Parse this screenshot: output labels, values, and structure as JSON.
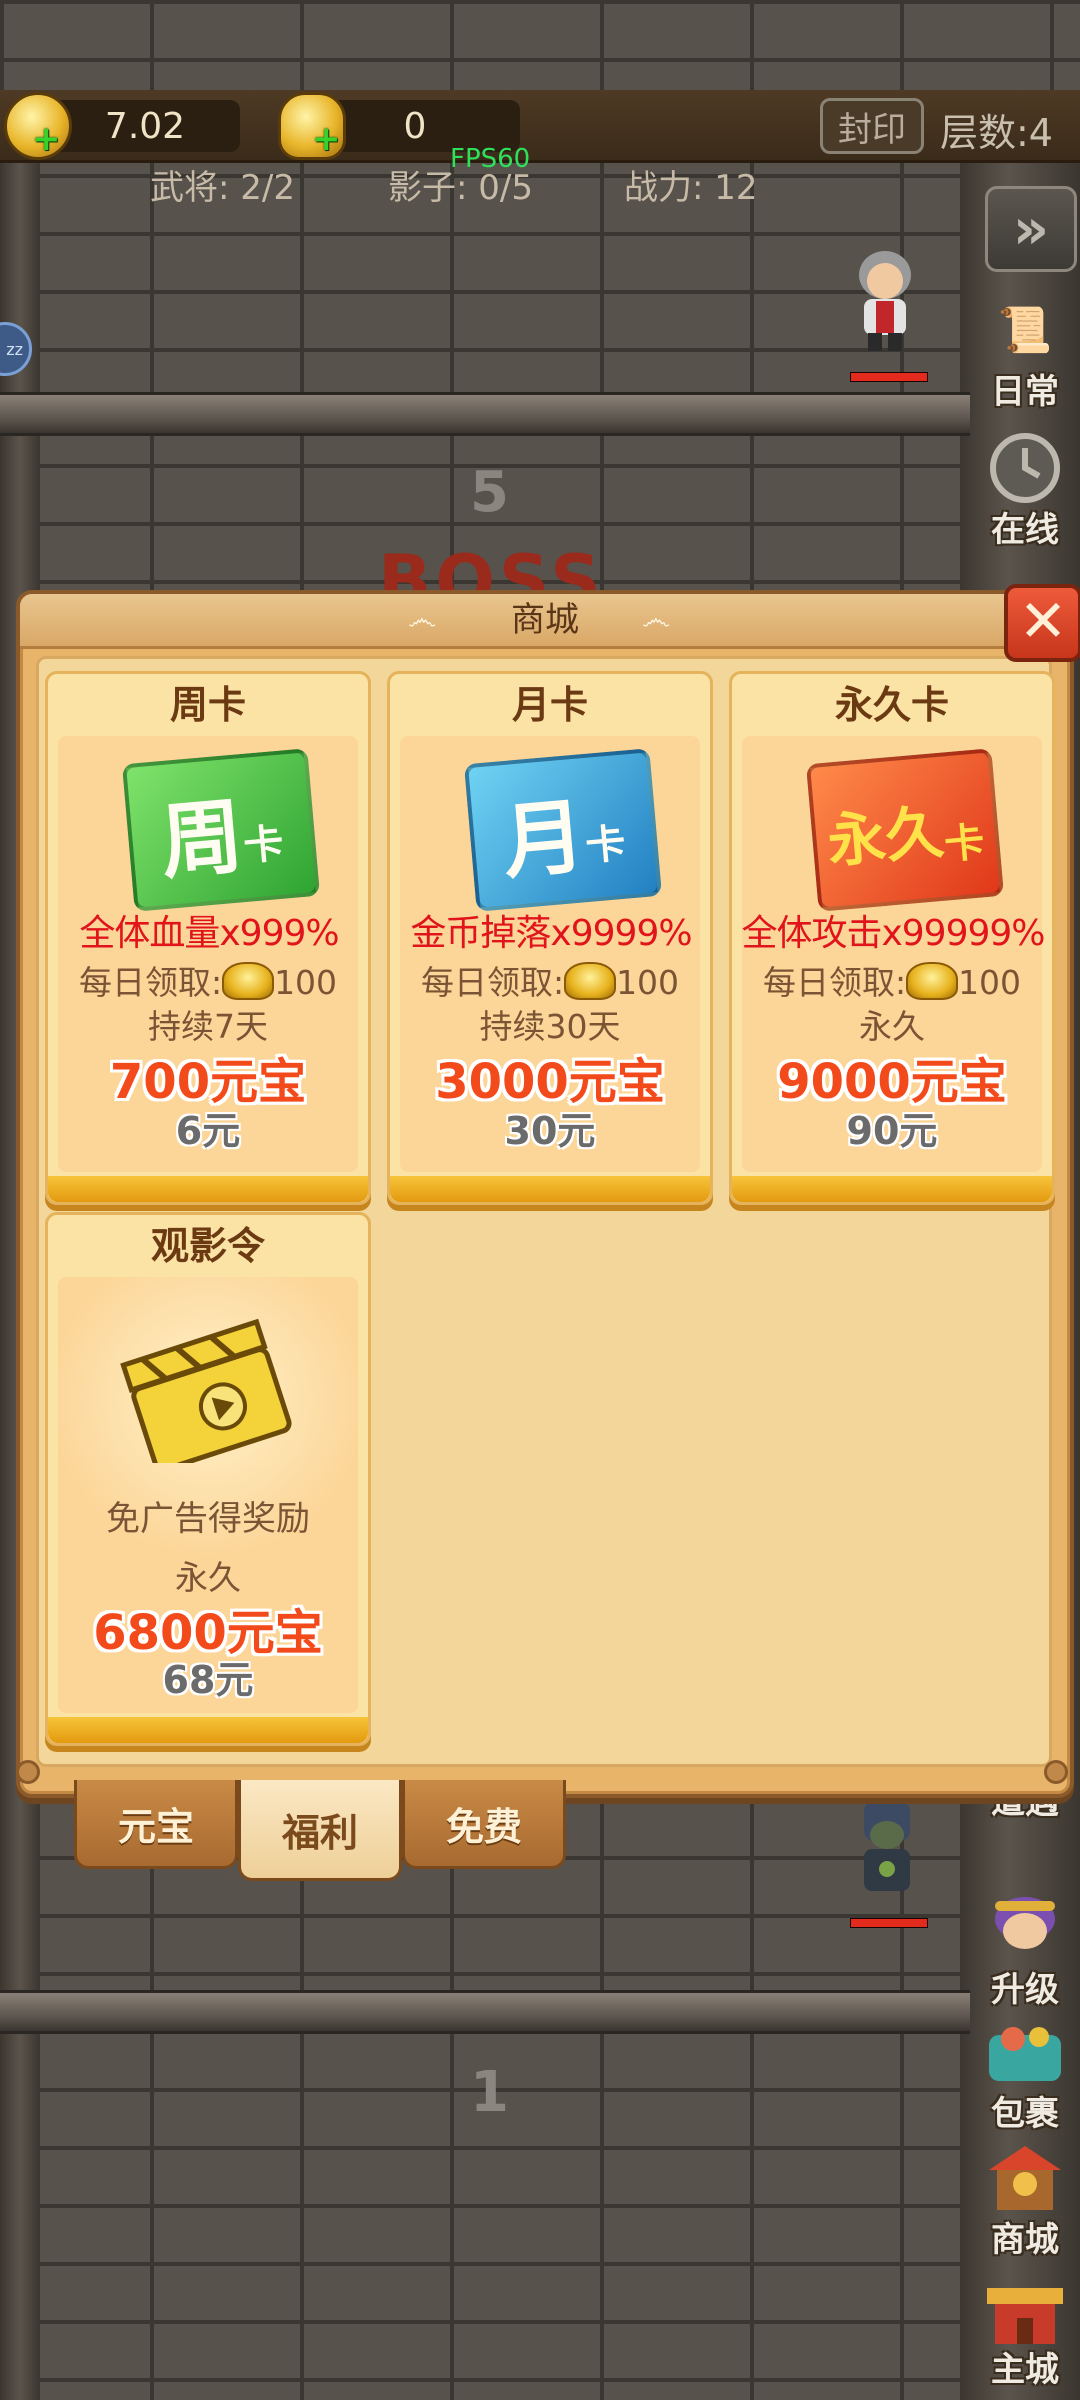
{
  "hud": {
    "gold_value": "7.02",
    "ingot_value": "0",
    "seal_button": "封印",
    "layer_label": "层数:4",
    "fps": "FPS60",
    "generals": "武将: 2/2",
    "shadows": "影子: 0/5",
    "power": "战力: 12"
  },
  "tower": {
    "floor_top": "5",
    "boss_label": "BOSS",
    "floor_bottom": "1"
  },
  "side_menu": {
    "daily": "日常",
    "online": "在线",
    "encounter": "遭遇",
    "upgrade": "升级",
    "bag": "包裹",
    "shop": "商城",
    "main_city": "主城"
  },
  "shop": {
    "title": "商城",
    "cards": [
      {
        "title": "周卡",
        "art_main": "周",
        "art_sub": "卡",
        "effect": "全体血量x999%",
        "daily_prefix": "每日领取:",
        "daily_amount": "100",
        "duration": "持续7天",
        "price": "700元宝",
        "rmb": "6元",
        "color": "#3fbe3a"
      },
      {
        "title": "月卡",
        "art_main": "月",
        "art_sub": "卡",
        "effect": "金币掉落x9999%",
        "daily_prefix": "每日领取:",
        "daily_amount": "100",
        "duration": "持续30天",
        "price": "3000元宝",
        "rmb": "30元",
        "color": "#2a9fd9"
      },
      {
        "title": "永久卡",
        "art_main": "永久",
        "art_sub": "卡",
        "effect": "全体攻击x99999%",
        "daily_prefix": "每日领取:",
        "daily_amount": "100",
        "duration": "永久",
        "price": "9000元宝",
        "rmb": "90元",
        "color": "#ef5527"
      },
      {
        "title": "观影令",
        "effect": "免广告得奖励",
        "duration": "永久",
        "price": "6800元宝",
        "rmb": "68元"
      }
    ]
  },
  "tabs": {
    "ingot": "元宝",
    "welfare": "福利",
    "free": "免费"
  }
}
